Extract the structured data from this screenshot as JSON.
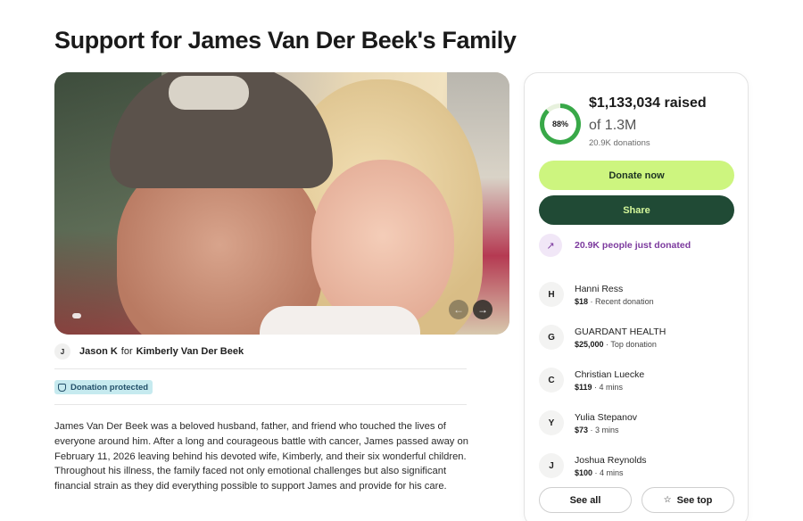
{
  "page": {
    "title": "Support for James Van Der Beek's Family"
  },
  "organizer": {
    "initial": "J",
    "name": "Jason K",
    "for_text": "for",
    "beneficiary": "Kimberly Van Der Beek"
  },
  "badge": {
    "label": "Donation protected"
  },
  "story": {
    "text": "James Van Der Beek was a beloved husband, father, and friend who touched the lives of everyone around him. After a long and courageous battle with cancer, James passed away on February 11, 2026 leaving behind his devoted wife, Kimberly, and their six wonderful children. Throughout his illness, the family faced not only emotional challenges but also significant financial strain as they did everything possible to support James and provide for his care."
  },
  "campaign": {
    "progress_percent": 88,
    "progress_label": "88%",
    "raised": "$1,133,034 raised",
    "goal": "of 1.3M",
    "donations": "20.9K donations",
    "donate_label": "Donate now",
    "share_label": "Share",
    "trend_text": "20.9K people just donated",
    "see_all_label": "See all",
    "see_top_label": "See top"
  },
  "donors": [
    {
      "initial": "H",
      "name": "Hanni Ress",
      "amount": "$18",
      "note": " · Recent donation"
    },
    {
      "initial": "G",
      "name": "GUARDANT HEALTH",
      "amount": "$25,000",
      "note": " · Top donation"
    },
    {
      "initial": "C",
      "name": "Christian Luecke",
      "amount": "$119",
      "note": " · 4 mins"
    },
    {
      "initial": "Y",
      "name": "Yulia Stepanov",
      "amount": "$73",
      "note": " · 3 mins"
    },
    {
      "initial": "J",
      "name": "Joshua Reynolds",
      "amount": "$100",
      "note": " · 4 mins"
    }
  ],
  "colors": {
    "progress": "#38a848",
    "donate_bg": "#cdf57f",
    "share_bg": "#204a35",
    "trend": "#7c3a9e",
    "badge_bg": "#c6eaef"
  }
}
